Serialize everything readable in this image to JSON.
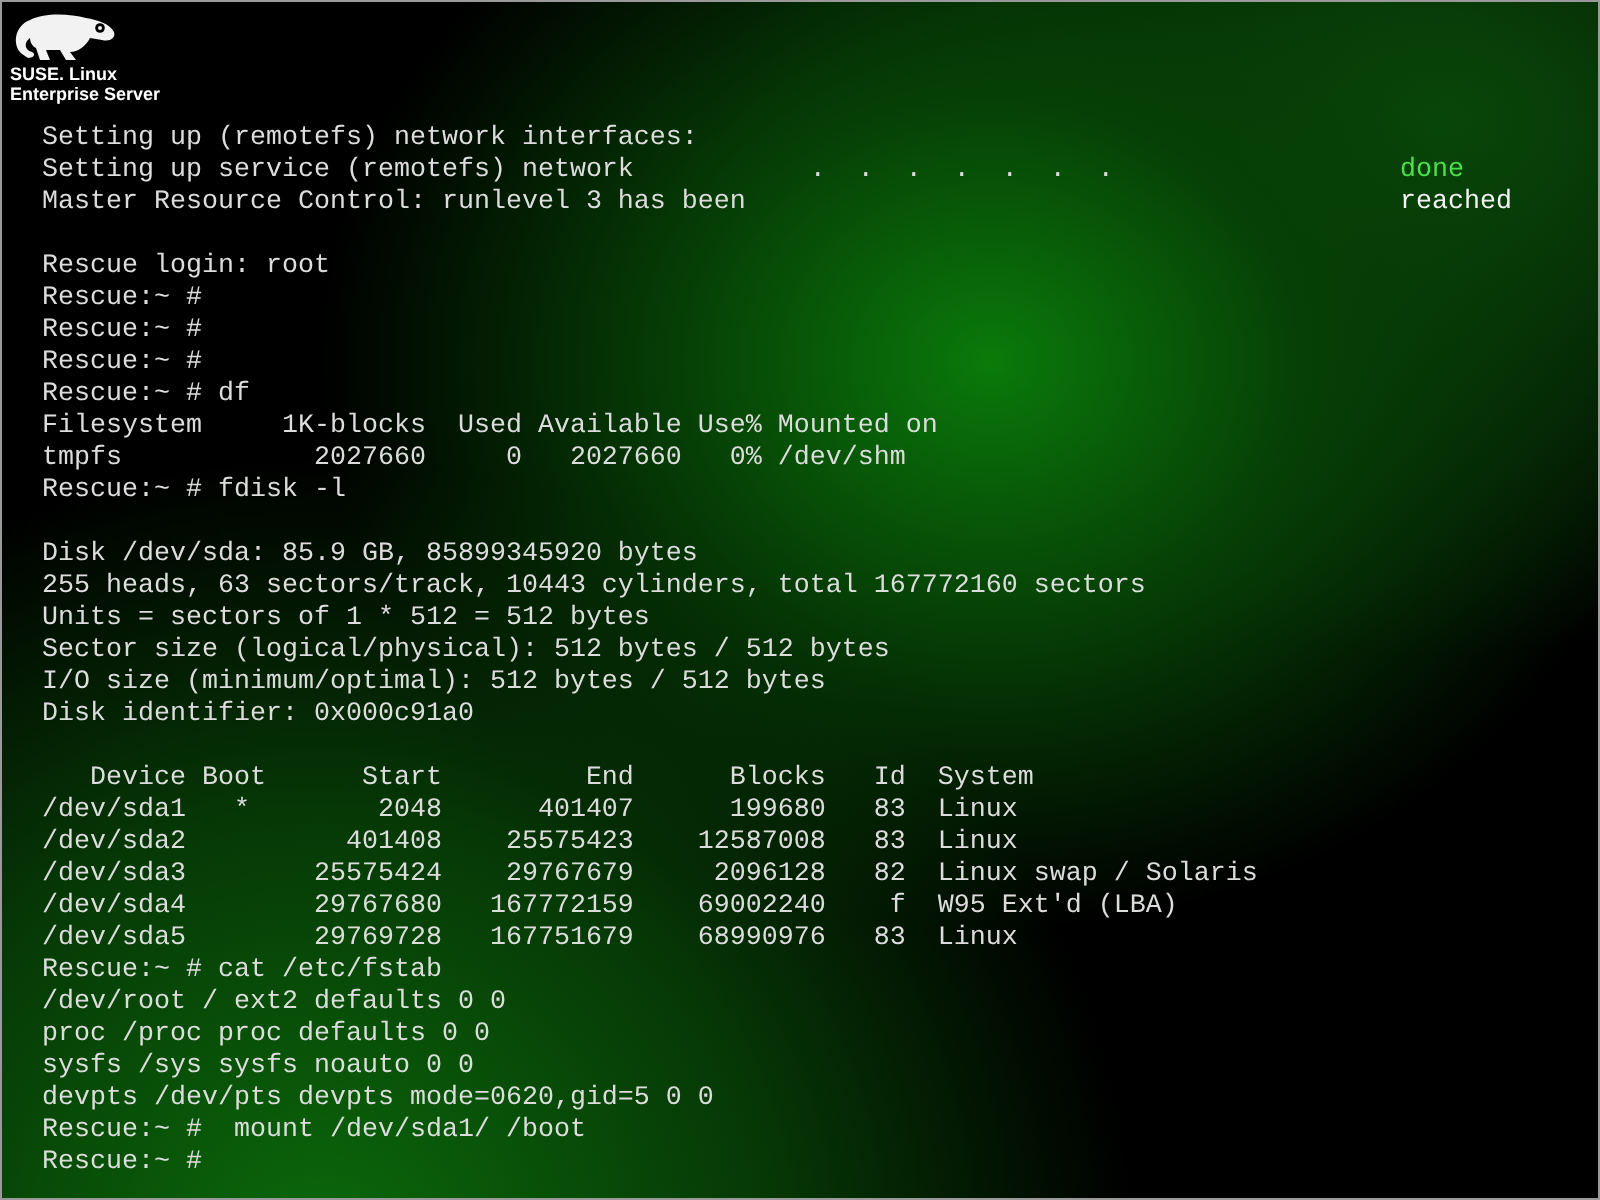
{
  "logo": {
    "lines": [
      "SUSE. Linux",
      "Enterprise Server"
    ]
  },
  "console": {
    "lines": [
      {
        "kind": "text",
        "text": "Setting up (remotefs) network interfaces:"
      },
      {
        "kind": "status",
        "text": "Setting up service (remotefs) network           .  .  .  .  .  .  .",
        "status": "done",
        "color": "#4ce04c"
      },
      {
        "kind": "status",
        "text": "Master Resource Control: runlevel 3 has been",
        "status": "reached",
        "color": "#f2f2f2"
      },
      {
        "kind": "blank"
      },
      {
        "kind": "text",
        "text": "Rescue login: root"
      },
      {
        "kind": "text",
        "text": "Rescue:~ #"
      },
      {
        "kind": "text",
        "text": "Rescue:~ #"
      },
      {
        "kind": "text",
        "text": "Rescue:~ #"
      },
      {
        "kind": "text",
        "text": "Rescue:~ # df"
      },
      {
        "kind": "text",
        "text": "Filesystem     1K-blocks  Used Available Use% Mounted on"
      },
      {
        "kind": "text",
        "text": "tmpfs            2027660     0   2027660   0% /dev/shm"
      },
      {
        "kind": "text",
        "text": "Rescue:~ # fdisk -l"
      },
      {
        "kind": "blank"
      },
      {
        "kind": "text",
        "text": "Disk /dev/sda: 85.9 GB, 85899345920 bytes"
      },
      {
        "kind": "text",
        "text": "255 heads, 63 sectors/track, 10443 cylinders, total 167772160 sectors"
      },
      {
        "kind": "text",
        "text": "Units = sectors of 1 * 512 = 512 bytes"
      },
      {
        "kind": "text",
        "text": "Sector size (logical/physical): 512 bytes / 512 bytes"
      },
      {
        "kind": "text",
        "text": "I/O size (minimum/optimal): 512 bytes / 512 bytes"
      },
      {
        "kind": "text",
        "text": "Disk identifier: 0x000c91a0"
      },
      {
        "kind": "blank"
      },
      {
        "kind": "text",
        "text": "   Device Boot      Start         End      Blocks   Id  System"
      },
      {
        "kind": "text",
        "text": "/dev/sda1   *        2048      401407      199680   83  Linux"
      },
      {
        "kind": "text",
        "text": "/dev/sda2          401408    25575423    12587008   83  Linux"
      },
      {
        "kind": "text",
        "text": "/dev/sda3        25575424    29767679     2096128   82  Linux swap / Solaris"
      },
      {
        "kind": "text",
        "text": "/dev/sda4        29767680   167772159    69002240    f  W95 Ext'd (LBA)"
      },
      {
        "kind": "text",
        "text": "/dev/sda5        29769728   167751679    68990976   83  Linux"
      },
      {
        "kind": "text",
        "text": "Rescue:~ # cat /etc/fstab"
      },
      {
        "kind": "text",
        "text": "/dev/root / ext2 defaults 0 0"
      },
      {
        "kind": "text",
        "text": "proc /proc proc defaults 0 0"
      },
      {
        "kind": "text",
        "text": "sysfs /sys sysfs noauto 0 0"
      },
      {
        "kind": "text",
        "text": "devpts /dev/pts devpts mode=0620,gid=5 0 0"
      },
      {
        "kind": "text",
        "text": "Rescue:~ #  mount /dev/sda1/ /boot"
      },
      {
        "kind": "text",
        "text": "Rescue:~ #"
      }
    ]
  }
}
